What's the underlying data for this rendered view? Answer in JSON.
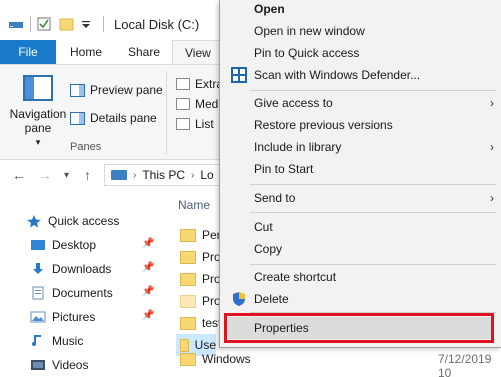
{
  "window": {
    "title": "Local Disk (C:)"
  },
  "ribbon": {
    "tabs": [
      "File",
      "Home",
      "Share",
      "View"
    ],
    "navigation_pane_label": "Navigation pane",
    "preview_pane_label": "Preview pane",
    "details_pane_label": "Details pane",
    "panes_group_label": "Panes",
    "layout_items": [
      "Extra",
      "Med",
      "List"
    ]
  },
  "address": {
    "crumbs": [
      "This PC",
      "Lo"
    ]
  },
  "sidebar": {
    "items": [
      {
        "label": "Quick access",
        "icon": "star-icon"
      },
      {
        "label": "Desktop",
        "icon": "desktop-icon"
      },
      {
        "label": "Downloads",
        "icon": "download-icon"
      },
      {
        "label": "Documents",
        "icon": "documents-icon"
      },
      {
        "label": "Pictures",
        "icon": "pictures-icon"
      },
      {
        "label": "Music",
        "icon": "music-icon"
      },
      {
        "label": "Videos",
        "icon": "videos-icon"
      }
    ]
  },
  "filelist": {
    "column_name": "Name",
    "rows": [
      {
        "name": "Perf"
      },
      {
        "name": "Prog"
      },
      {
        "name": "Prog"
      },
      {
        "name": "Prog"
      },
      {
        "name": "test"
      },
      {
        "name": "Use"
      },
      {
        "name": "Windows",
        "date": "7/12/2019 10"
      }
    ]
  },
  "context_menu": {
    "items": [
      {
        "label": "Open",
        "bold": true
      },
      {
        "label": "Open in new window"
      },
      {
        "label": "Pin to Quick access"
      },
      {
        "label": "Scan with Windows Defender...",
        "icon": "windows-defender-icon"
      },
      {
        "label": "Give access to",
        "submenu": true
      },
      {
        "label": "Restore previous versions"
      },
      {
        "label": "Include in library",
        "submenu": true
      },
      {
        "label": "Pin to Start"
      },
      {
        "label": "Send to",
        "submenu": true
      },
      {
        "label": "Cut"
      },
      {
        "label": "Copy"
      },
      {
        "label": "Create shortcut"
      },
      {
        "label": "Delete",
        "icon": "uac-shield-icon"
      },
      {
        "label": "Properties",
        "highlighted": true
      }
    ],
    "highlight_color": "#e0141e"
  }
}
